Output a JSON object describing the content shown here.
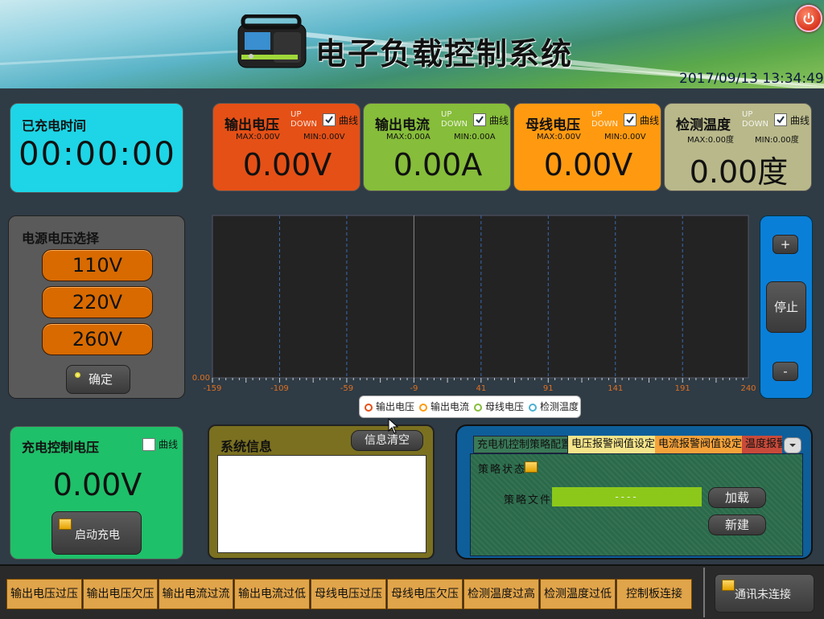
{
  "header": {
    "title": "电子负载控制系统",
    "datetime": "2017/09/13  13:34:49"
  },
  "charge_time": {
    "label": "已充电时间",
    "value": "00:00:00"
  },
  "meters": [
    {
      "title": "输出电压",
      "up": "UP",
      "down": "DOWN",
      "curve_label": "曲线",
      "checked": true,
      "max": "MAX:0.00V",
      "min": "MIN:0.00V",
      "value": "0.00V",
      "color": "#e55016"
    },
    {
      "title": "输出电流",
      "up": "UP",
      "down": "DOWN",
      "curve_label": "曲线",
      "checked": true,
      "max": "MAX:0.00A",
      "min": "MIN:0.00A",
      "value": "0.00A",
      "color": "#86bd3a"
    },
    {
      "title": "母线电压",
      "up": "UP",
      "down": "DOWN",
      "curve_label": "曲线",
      "checked": true,
      "max": "MAX:0.00V",
      "min": "MIN:0.00V",
      "value": "0.00V",
      "color": "#ff9a10"
    },
    {
      "title": "检测温度",
      "up": "UP",
      "down": "DOWN",
      "curve_label": "曲线",
      "checked": true,
      "max": "MAX:0.00度",
      "min": "MIN:0.00度",
      "value": "0.00度",
      "color": "#b8b88a"
    }
  ],
  "power_select": {
    "title": "电源电压选择",
    "options": [
      "110V",
      "220V",
      "260V"
    ],
    "confirm_label": "确定"
  },
  "chart_controls": {
    "plus": "+",
    "stop": "停止",
    "minus": "-"
  },
  "chart_data": {
    "type": "line",
    "x_ticks": [
      "-159",
      "-109",
      "-59",
      "-9",
      "41",
      "91",
      "141",
      "191",
      "240"
    ],
    "y_ticks": [
      "0.00"
    ],
    "xlim": [
      -159,
      240
    ],
    "grid": true,
    "legend_position": "bottom",
    "series": [
      {
        "name": "输出电压",
        "values": [],
        "color": "#e55016"
      },
      {
        "name": "输出电流",
        "values": [],
        "color": "#ff9a10"
      },
      {
        "name": "母线电压",
        "values": [],
        "color": "#86bd3a"
      },
      {
        "name": "检测温度",
        "values": [],
        "color": "#4ab0d0"
      }
    ]
  },
  "charge_control": {
    "title": "充电控制电压",
    "curve_label": "曲线",
    "value": "0.00V",
    "start_label": "启动充电"
  },
  "sys_info": {
    "title": "系统信息",
    "clear_label": "信息清空"
  },
  "strategy": {
    "tabs": [
      "充电机控制策略配置",
      "电压报警阀值设定",
      "电流报警阀值设定",
      "温度报警"
    ],
    "status_label": "策略状态",
    "file_label": "策略文件",
    "file_value": "----",
    "load_label": "加载",
    "new_label": "新建"
  },
  "alarms": [
    "输出电压过压",
    "输出电压欠压",
    "输出电流过流",
    "输出电流过低",
    "母线电压过压",
    "母线电压欠压",
    "检测温度过高",
    "检测温度过低",
    "控制板连接"
  ],
  "comm_status": "通讯未连接"
}
